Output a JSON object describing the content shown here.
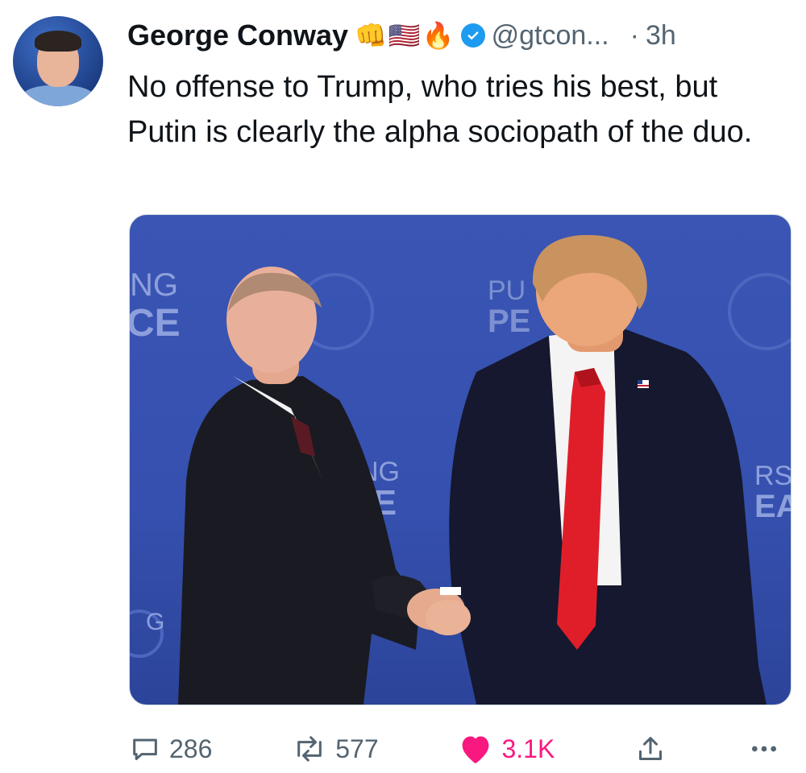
{
  "tweet": {
    "author_name": "George Conway",
    "author_emojis": [
      "👊",
      "🇺🇸",
      "🔥"
    ],
    "handle": "@gtcon...",
    "separator": "·",
    "time": "3h",
    "text": "No offense to Trump, who tries his best, but Putin is clearly the alpha sociopath of the duo.",
    "media": {
      "backdrop_left_lines": [
        "NG",
        "CE"
      ],
      "backdrop_center_lines": [
        "UING",
        "CE"
      ],
      "backdrop_top_right_lines": [
        "PU",
        "PE"
      ],
      "backdrop_far_right_lines": [
        "RS",
        "EA"
      ],
      "backdrop_bottom_left": "G"
    },
    "actions": {
      "replies": "286",
      "reposts": "577",
      "likes": "3.1K"
    }
  },
  "colors": {
    "accent_blue": "#1d9bf0",
    "like_pink": "#f91880",
    "secondary_text": "#536471",
    "backdrop_blue": "#3550ae"
  },
  "icons": [
    "reply-icon",
    "repost-icon",
    "like-icon",
    "share-icon",
    "more-icon",
    "verified-icon"
  ]
}
